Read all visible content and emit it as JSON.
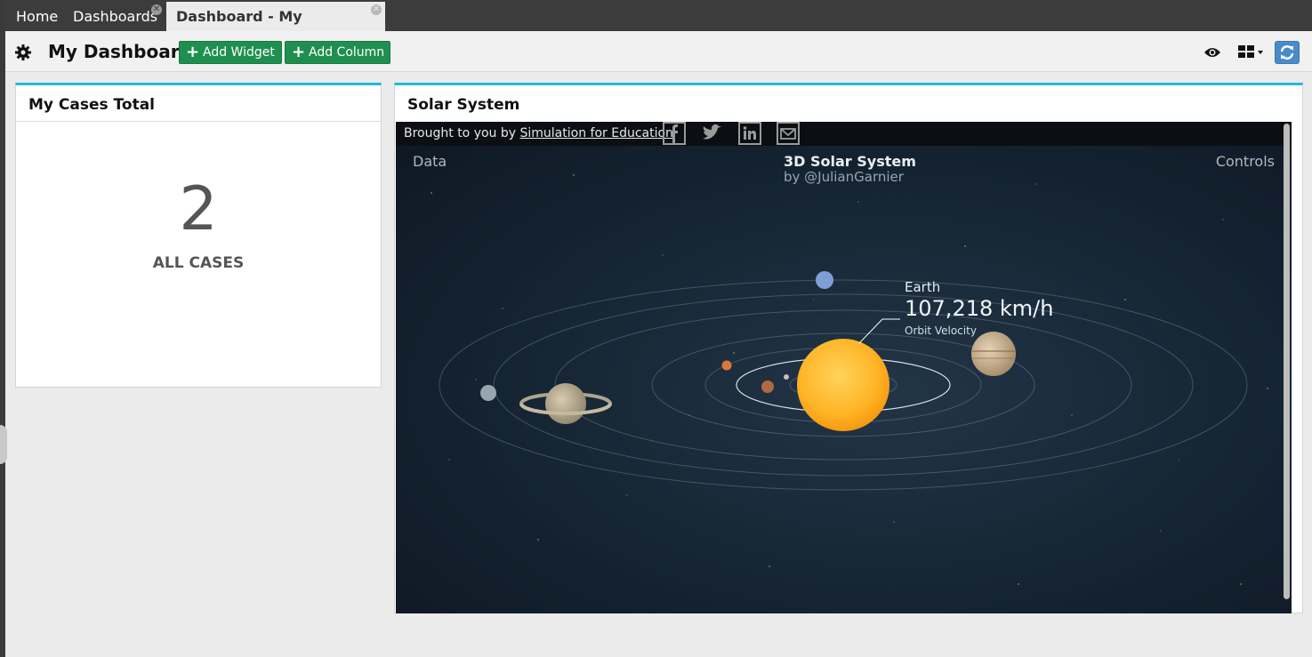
{
  "tabs": [
    {
      "label": "Home"
    },
    {
      "label": "Dashboards"
    },
    {
      "label": "Dashboard - My Dashboard"
    }
  ],
  "toolbar": {
    "title": "My Dashboard",
    "add_widget": "Add Widget",
    "add_column": "Add Column"
  },
  "widgets": {
    "cases": {
      "title": "My Cases Total",
      "count": "2",
      "label": "ALL CASES"
    },
    "solar": {
      "title": "Solar System",
      "credit_prefix": "Brought to you by ",
      "credit_link": "Simulation for Education",
      "data_label": "Data",
      "controls_label": "Controls",
      "sim_title": "3D Solar System",
      "sim_author": "by @JulianGarnier",
      "planet_name": "Earth",
      "planet_value": "107,218 km/h",
      "planet_metric": "Orbit Velocity"
    }
  },
  "colors": {
    "accent": "#21b8db",
    "green_button": "#1f8f4f",
    "refresh_button": "#4a8bc9"
  },
  "icons": [
    "gear-icon",
    "eye-icon",
    "layout-grid-icon",
    "refresh-icon",
    "facebook-icon",
    "twitter-icon",
    "linkedin-icon",
    "email-icon",
    "close-icon",
    "plus-icon"
  ]
}
